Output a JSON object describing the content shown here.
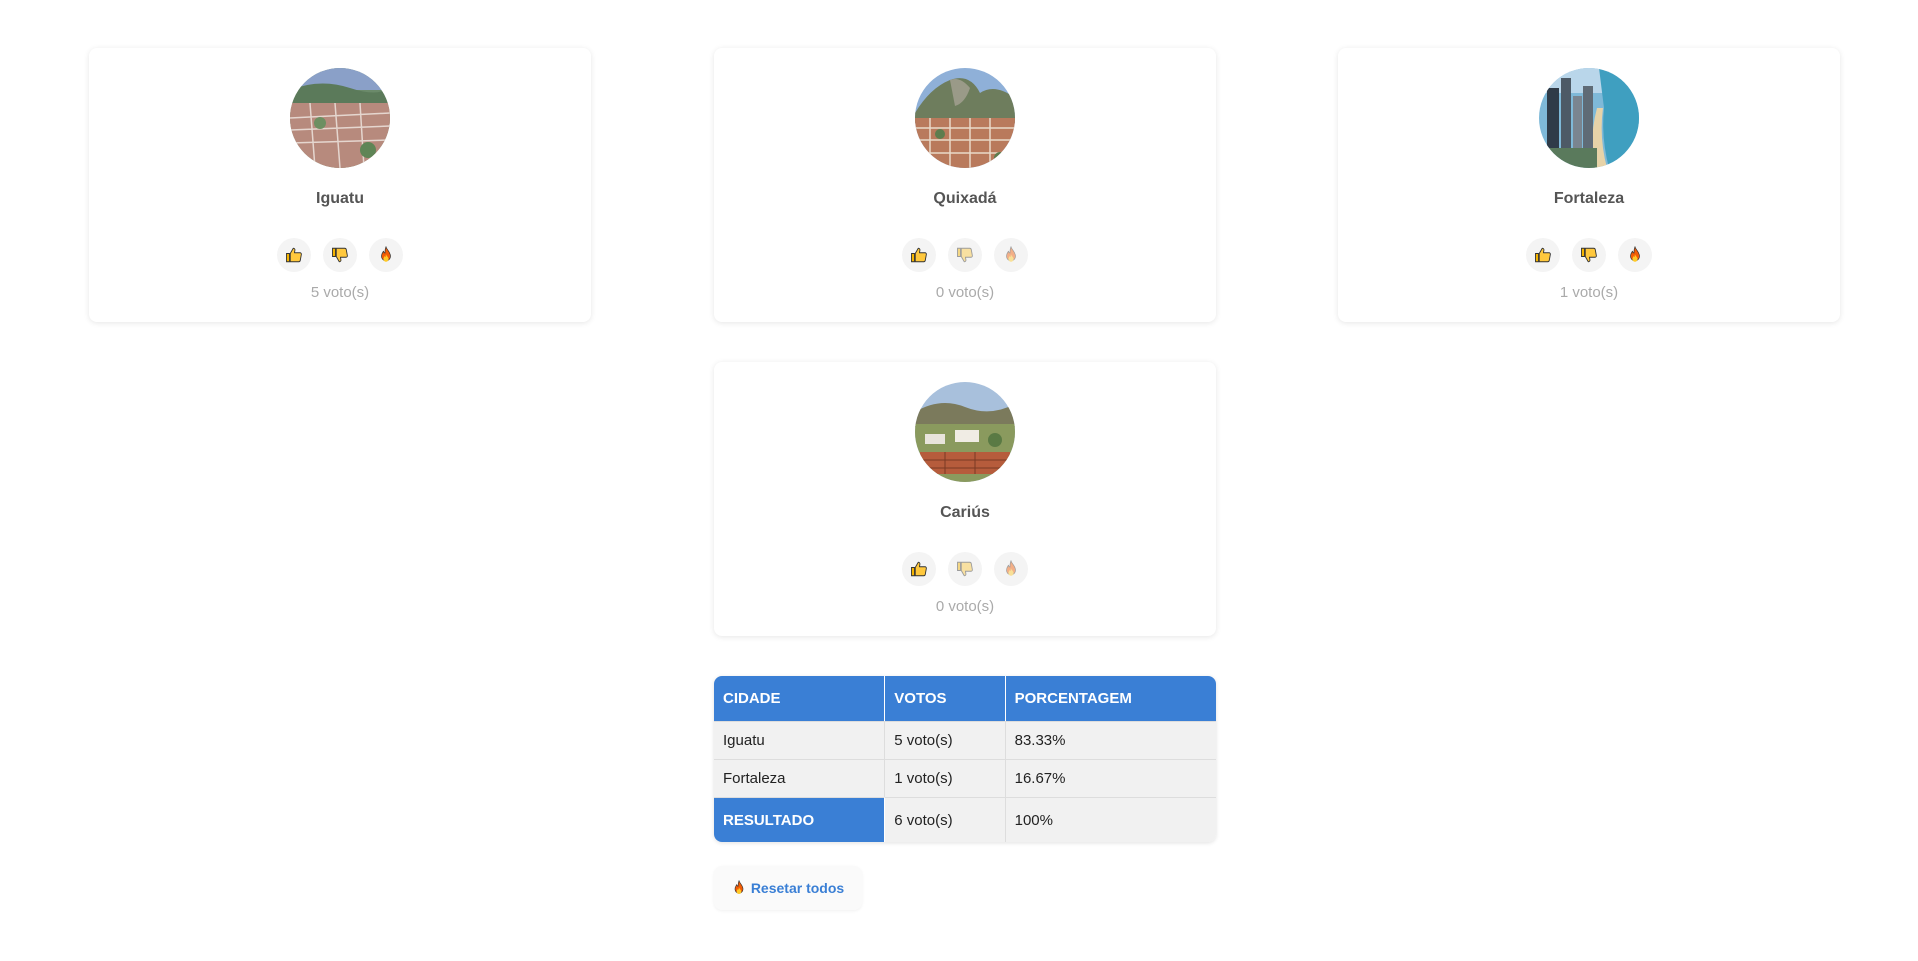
{
  "cards": [
    {
      "name": "Iguatu",
      "votes": "5 voto(s)",
      "image": "aerial-town-photo"
    },
    {
      "name": "Quixadá",
      "votes": "0 voto(s)",
      "image": "town-with-monolith-photo"
    },
    {
      "name": "Fortaleza",
      "votes": "1 voto(s)",
      "image": "coastal-city-photo"
    },
    {
      "name": "Cariús",
      "votes": "0 voto(s)",
      "image": "rural-town-photo"
    }
  ],
  "icons": {
    "like": "thumbs-up-icon",
    "dislike": "thumbs-down-icon",
    "fire": "fire-icon"
  },
  "table": {
    "headers": [
      "CIDADE",
      "VOTOS",
      "PORCENTAGEM"
    ],
    "rows": [
      [
        "Iguatu",
        "5 voto(s)",
        "83.33%"
      ],
      [
        "Fortaleza",
        "1 voto(s)",
        "16.67%"
      ]
    ],
    "total": [
      "RESULTADO",
      "6 voto(s)",
      "100%"
    ]
  },
  "reset": {
    "label": "Resetar todos"
  },
  "colors": {
    "accent": "#3a7fd5",
    "card_bg": "#ffffff",
    "muted_text": "#aaaaaa"
  }
}
